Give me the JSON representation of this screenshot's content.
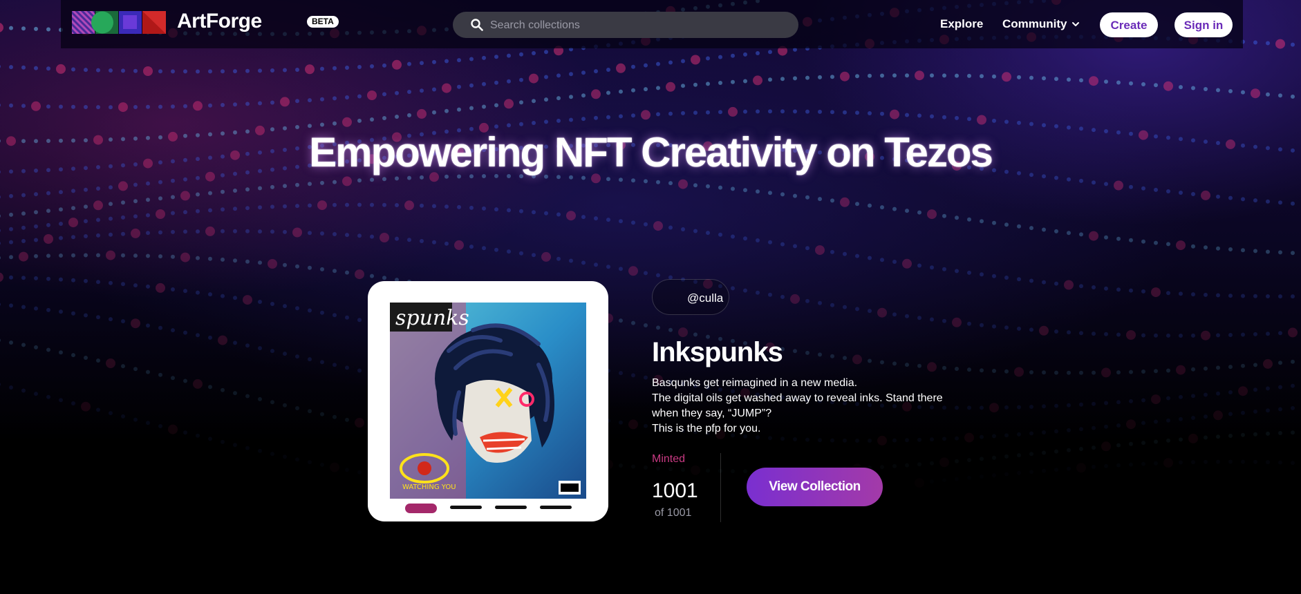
{
  "brand": {
    "name": "ArtForge",
    "badge": "BETA"
  },
  "search": {
    "placeholder": "Search collections"
  },
  "nav": {
    "explore": "Explore",
    "community": "Community",
    "create": "Create",
    "sign_in": "Sign in"
  },
  "hero": {
    "headline": "Empowering NFT Creativity on Tezos"
  },
  "featured": {
    "creator": "@culla",
    "title": "Inkspunks",
    "description": [
      "Basqunks get reimagined in a new media.",
      "The digital oils get washed away to reveal inks. Stand there",
      "when they say, “JUMP”?",
      "This is the pfp for you."
    ],
    "minted_label": "Minted",
    "minted_count": "1001",
    "minted_total": "of 1001",
    "view_button": "View Collection",
    "slides": {
      "count": 4,
      "active": 1
    },
    "artwork": {
      "text_top": "spunks",
      "text_eye": "WATCHING YOU"
    }
  },
  "colors": {
    "accent": "#7a2fd0",
    "minted": "#c93a83",
    "slide_active": "#a4286a",
    "button_text": "#6a2bb8"
  },
  "icons": {
    "search": "search-icon",
    "community_dropdown": "chevron-down-icon"
  }
}
